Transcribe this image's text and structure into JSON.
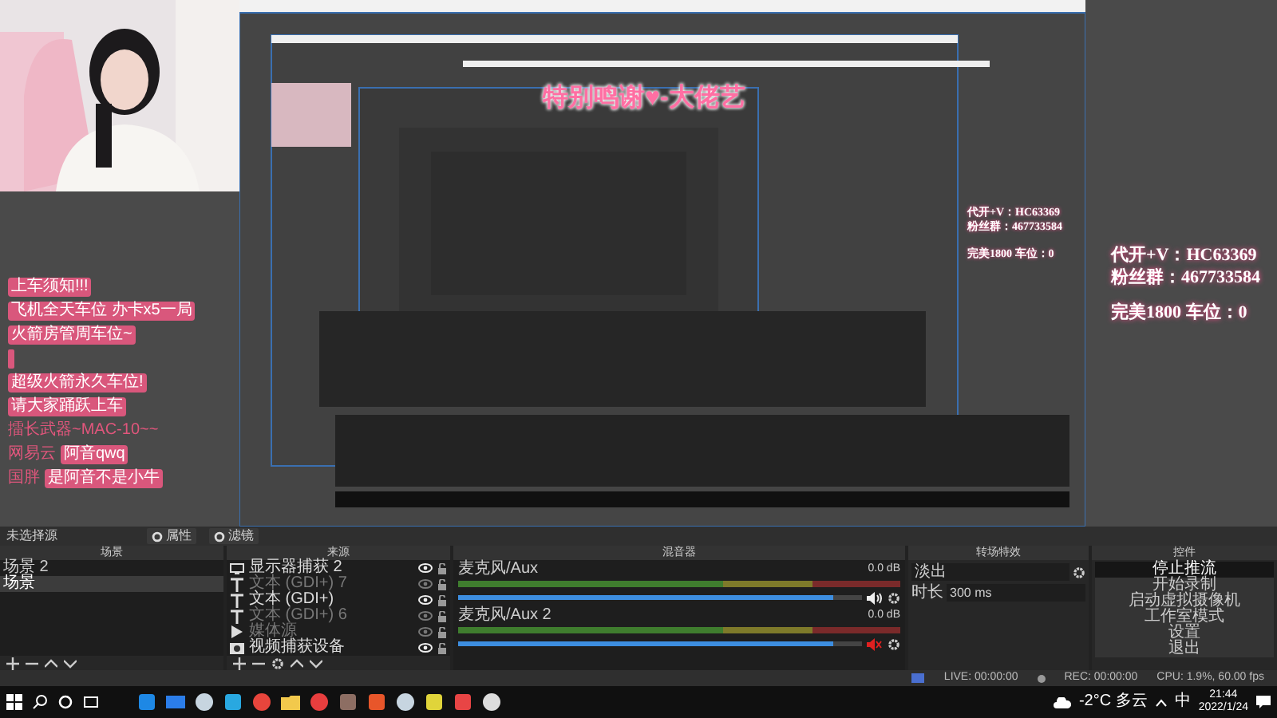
{
  "preview": {
    "title": "特别鸣谢♥-大佬艺",
    "notice_lines": [
      [
        {
          "text": "上车须知!!!",
          "kind": "tag"
        }
      ],
      [
        {
          "text": "飞机全天车位 办卡x5一局",
          "kind": "tag"
        }
      ],
      [
        {
          "text": "火箭房管周车位~",
          "kind": "tag"
        }
      ],
      [
        {
          "kind": "blank"
        }
      ],
      [
        {
          "text": "超级火箭永久车位!",
          "kind": "tag"
        }
      ],
      [
        {
          "text": "请大家踊跃上车",
          "kind": "tag"
        }
      ],
      [
        {
          "text": "擂长武器~MAC-10~~",
          "kind": "plain"
        }
      ],
      [
        {
          "text": "网易云",
          "kind": "plain"
        },
        {
          "text": "阿音qwq",
          "kind": "tag"
        }
      ],
      [
        {
          "text": "国胖",
          "kind": "plain"
        },
        {
          "text": "是阿音不是小牛",
          "kind": "tag"
        }
      ]
    ],
    "info_small": [
      "代开+V：HC63369",
      "粉丝群：467733584",
      "完美1800 车位：0"
    ],
    "info": [
      "代开+V：HC63369",
      "粉丝群：467733584",
      "完美1800 车位：0"
    ]
  },
  "toolbar": {
    "selection": "未选择源",
    "buttons": [
      "属性",
      "滤镜"
    ]
  },
  "scenes": {
    "title": "场景",
    "items": [
      {
        "label": "场景 2",
        "selected": false
      },
      {
        "label": "场景",
        "selected": true
      }
    ]
  },
  "sources": {
    "title": "来源",
    "items": [
      {
        "label": "显示器捕获 2",
        "kind": "display",
        "visible": true
      },
      {
        "label": "文本 (GDI+) 7",
        "kind": "text",
        "visible": false
      },
      {
        "label": "文本 (GDI+)",
        "kind": "text",
        "visible": true
      },
      {
        "label": "文本 (GDI+) 6",
        "kind": "text",
        "visible": false
      },
      {
        "label": "媒体源",
        "kind": "media",
        "visible": false
      },
      {
        "label": "视频捕获设备",
        "kind": "camera",
        "visible": true
      }
    ]
  },
  "mixer": {
    "title": "混音器",
    "channels": [
      {
        "name": "麦克风/Aux",
        "reading": "0.0 dB",
        "level": 0.93,
        "muted": false
      },
      {
        "name": "麦克风/Aux 2",
        "reading": "0.0 dB",
        "level": 0.93,
        "muted": true
      }
    ]
  },
  "transitions": {
    "title": "转场特效",
    "type": "淡出",
    "duration_label": "时长",
    "duration": "300 ms"
  },
  "controls": {
    "title": "控件",
    "buttons": [
      {
        "label": "停止推流",
        "active": true
      },
      {
        "label": "开始录制",
        "active": false
      },
      {
        "label": "启动虚拟摄像机",
        "active": false
      },
      {
        "label": "工作室模式",
        "active": false
      },
      {
        "label": "设置",
        "active": false
      },
      {
        "label": "退出",
        "active": false
      }
    ]
  },
  "status": {
    "live": "LIVE: 00:00:00",
    "rec": "REC: 00:00:00",
    "cpu": "CPU: 1.9%, 60.00 fps"
  },
  "taskbar": {
    "apps": [
      {
        "kind": "store",
        "color": "#1e88e5"
      },
      {
        "kind": "mail",
        "color": "#2b7de9"
      },
      {
        "kind": "steam",
        "color": "#c7d5e0"
      },
      {
        "kind": "app",
        "color": "#29a8e0"
      },
      {
        "kind": "browser",
        "color": "#e8453c"
      },
      {
        "kind": "folder",
        "color": "#f2c94c"
      },
      {
        "kind": "music",
        "color": "#e83e3e"
      },
      {
        "kind": "app",
        "color": "#8d6e63"
      },
      {
        "kind": "office",
        "color": "#e8562a"
      },
      {
        "kind": "steam",
        "color": "#c7d5e0"
      },
      {
        "kind": "app",
        "color": "#e0d43a"
      },
      {
        "kind": "app",
        "color": "#e84545"
      },
      {
        "kind": "obs",
        "color": "#dddddd"
      }
    ],
    "weather": "-2°C 多云",
    "ime": "中",
    "time": "21:44",
    "date": "2022/1/24"
  }
}
